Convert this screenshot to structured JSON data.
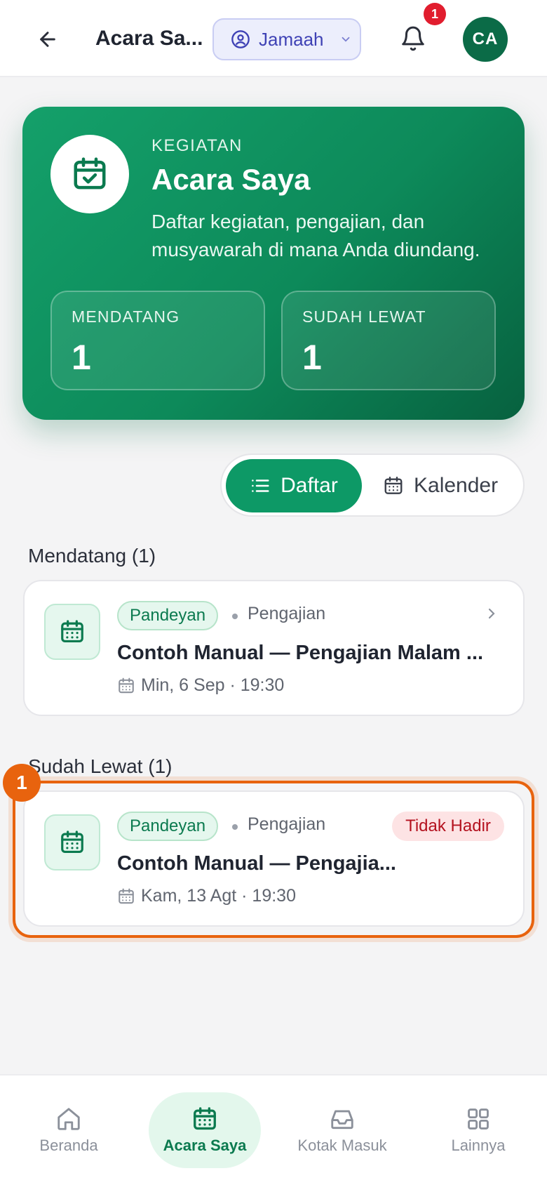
{
  "header": {
    "title": "Acara Sa...",
    "role": "Jamaah",
    "notification_count": "1",
    "avatar_initials": "CA"
  },
  "hero": {
    "kicker": "KEGIATAN",
    "title": "Acara Saya",
    "description": "Daftar kegiatan, pengajian, dan musyawarah di mana Anda diundang.",
    "stats": [
      {
        "label": "MENDATANG",
        "value": "1"
      },
      {
        "label": "SUDAH LEWAT",
        "value": "1"
      }
    ]
  },
  "view_toggle": {
    "list_label": "Daftar",
    "calendar_label": "Kalender",
    "selected": "Daftar"
  },
  "sections": {
    "upcoming": {
      "title": "Mendatang (1)",
      "items": [
        {
          "group": "Pandeyan",
          "type": "Pengajian",
          "title": "Contoh Manual — Pengajian Malam ...",
          "datetime": "Min, 6 Sep · 19:30"
        }
      ]
    },
    "past": {
      "title": "Sudah Lewat (1)",
      "items": [
        {
          "group": "Pandeyan",
          "type": "Pengajian",
          "title": "Contoh Manual — Pengajia...",
          "datetime": "Kam, 13 Agt · 19:30",
          "status": "Tidak Hadir"
        }
      ]
    }
  },
  "annotation": {
    "step": "1"
  },
  "bottom_nav": [
    {
      "label": "Beranda",
      "icon": "home-icon"
    },
    {
      "label": "Acara Saya",
      "icon": "calendar-icon",
      "active": true
    },
    {
      "label": "Kotak Masuk",
      "icon": "inbox-icon"
    },
    {
      "label": "Lainnya",
      "icon": "grid-icon"
    }
  ],
  "colors": {
    "primary": "#0d9966",
    "primary_dark": "#07613f",
    "accent_highlight": "#e8630e",
    "danger": "#b4121f",
    "role_pill": "#3f42b5"
  }
}
